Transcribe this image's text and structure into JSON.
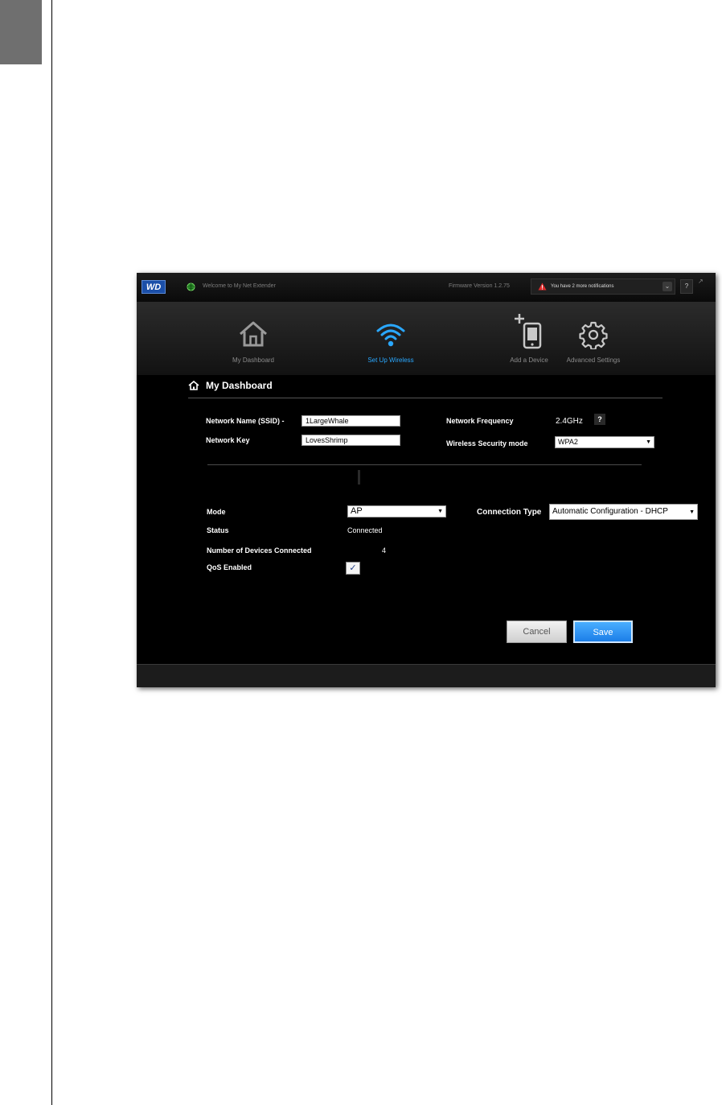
{
  "topbar": {
    "logo": "WD",
    "welcome": "Welcome to My Net Extender",
    "firmware": "Firmware Version 1.2.75",
    "notification": "You have 2 more notifications",
    "help": "?"
  },
  "nav": {
    "items": [
      {
        "label": "My Dashboard",
        "icon": "home-icon"
      },
      {
        "label": "Set Up Wireless",
        "icon": "wifi-icon",
        "active": true
      },
      {
        "label": "Add a Device",
        "icon": "add-device-icon"
      },
      {
        "label": "Advanced Settings",
        "icon": "gear-icon"
      }
    ]
  },
  "section": {
    "title": "My Dashboard"
  },
  "wireless": {
    "ssid_label": "Network Name (SSID) -",
    "ssid_value": "1LargeWhale",
    "key_label": "Network Key",
    "key_value": "LovesShrimp",
    "frequency_label": "Network Frequency",
    "frequency_value": "2.4GHz",
    "security_label": "Wireless Security mode",
    "security_value": "WPA2"
  },
  "status": {
    "mode_label": "Mode",
    "mode_value": "AP",
    "status_label": "Status",
    "status_value": "Connected",
    "devices_label": "Number of Devices Connected",
    "devices_value": "4",
    "qos_label": "QoS Enabled",
    "qos_checked": true,
    "connection_label": "Connection Type",
    "connection_value": "Automatic Configuration - DHCP"
  },
  "buttons": {
    "cancel": "Cancel",
    "save": "Save"
  },
  "colors": {
    "accent": "#2aa8ff",
    "save_button": "#1b7ee8",
    "logo_bg": "#1b4fa8"
  }
}
